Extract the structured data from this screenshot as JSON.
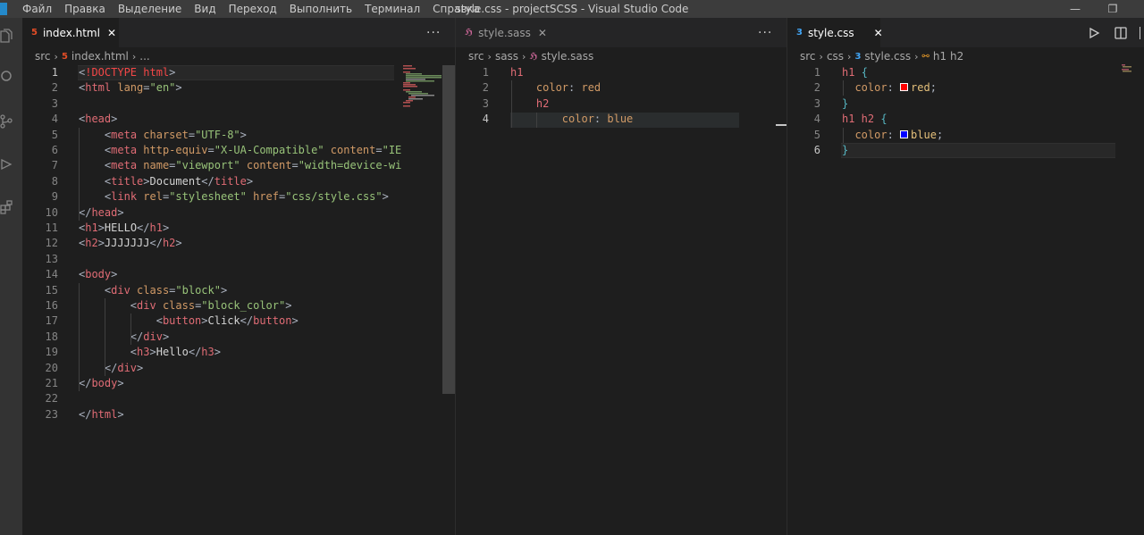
{
  "window": {
    "title": "style.css - projectSCSS - Visual Studio Code",
    "menu": [
      "Файл",
      "Правка",
      "Выделение",
      "Вид",
      "Переход",
      "Выполнить",
      "Терминал",
      "Справка"
    ],
    "minimize": "—",
    "restore": "❐"
  },
  "activity_icons": [
    "files-icon",
    "search-icon",
    "source-control-icon",
    "run-debug-icon",
    "extensions-icon"
  ],
  "pane1": {
    "tab": {
      "icon": "5",
      "label": "index.html",
      "close": "✕"
    },
    "more": "···",
    "breadcrumb": [
      "src",
      "index.html",
      "..."
    ],
    "lines": [
      {
        "n": "1",
        "parts": [
          [
            "pun",
            "<"
          ],
          [
            "tag",
            "!DOCTYPE html"
          ],
          [
            "pun",
            ">"
          ]
        ]
      },
      {
        "n": "2",
        "parts": [
          [
            "pun",
            "<"
          ],
          [
            "tag2",
            "html "
          ],
          [
            "attr",
            "lang"
          ],
          [
            "pun",
            "="
          ],
          [
            "str",
            "\"en\""
          ],
          [
            "pun",
            ">"
          ]
        ]
      },
      {
        "n": "3",
        "parts": []
      },
      {
        "n": "4",
        "parts": [
          [
            "pun",
            "<"
          ],
          [
            "tag2",
            "head"
          ],
          [
            "pun",
            ">"
          ]
        ]
      },
      {
        "n": "5",
        "parts": [
          [
            "plain",
            "    "
          ],
          [
            "pun",
            "<"
          ],
          [
            "tag2",
            "meta "
          ],
          [
            "attr",
            "charset"
          ],
          [
            "pun",
            "="
          ],
          [
            "str",
            "\"UTF-8\""
          ],
          [
            "pun",
            ">"
          ]
        ]
      },
      {
        "n": "6",
        "parts": [
          [
            "plain",
            "    "
          ],
          [
            "pun",
            "<"
          ],
          [
            "tag2",
            "meta "
          ],
          [
            "attr",
            "http-equiv"
          ],
          [
            "pun",
            "="
          ],
          [
            "str",
            "\"X-UA-Compatible\" "
          ],
          [
            "attr",
            "content"
          ],
          [
            "pun",
            "="
          ],
          [
            "str",
            "\"IE"
          ]
        ]
      },
      {
        "n": "7",
        "parts": [
          [
            "plain",
            "    "
          ],
          [
            "pun",
            "<"
          ],
          [
            "tag2",
            "meta "
          ],
          [
            "attr",
            "name"
          ],
          [
            "pun",
            "="
          ],
          [
            "str",
            "\"viewport\" "
          ],
          [
            "attr",
            "content"
          ],
          [
            "pun",
            "="
          ],
          [
            "str",
            "\"width=device-wi"
          ]
        ]
      },
      {
        "n": "8",
        "parts": [
          [
            "plain",
            "    "
          ],
          [
            "pun",
            "<"
          ],
          [
            "tag2",
            "title"
          ],
          [
            "pun",
            ">"
          ],
          [
            "plain",
            "Document"
          ],
          [
            "pun",
            "</"
          ],
          [
            "tag2",
            "title"
          ],
          [
            "pun",
            ">"
          ]
        ]
      },
      {
        "n": "9",
        "parts": [
          [
            "plain",
            "    "
          ],
          [
            "pun",
            "<"
          ],
          [
            "tag2",
            "link "
          ],
          [
            "attr",
            "rel"
          ],
          [
            "pun",
            "="
          ],
          [
            "str",
            "\"stylesheet\" "
          ],
          [
            "attr",
            "href"
          ],
          [
            "pun",
            "="
          ],
          [
            "str",
            "\"css/style.css\""
          ],
          [
            "pun",
            ">"
          ]
        ]
      },
      {
        "n": "10",
        "parts": [
          [
            "pun",
            "</"
          ],
          [
            "tag2",
            "head"
          ],
          [
            "pun",
            ">"
          ]
        ]
      },
      {
        "n": "11",
        "parts": [
          [
            "pun",
            "<"
          ],
          [
            "tag2",
            "h1"
          ],
          [
            "pun",
            ">"
          ],
          [
            "plain",
            "HELLO"
          ],
          [
            "pun",
            "</"
          ],
          [
            "tag2",
            "h1"
          ],
          [
            "pun",
            ">"
          ]
        ]
      },
      {
        "n": "12",
        "parts": [
          [
            "pun",
            "<"
          ],
          [
            "tag2",
            "h2"
          ],
          [
            "pun",
            ">"
          ],
          [
            "plain",
            "JJJJJJJ"
          ],
          [
            "pun",
            "</"
          ],
          [
            "tag2",
            "h2"
          ],
          [
            "pun",
            ">"
          ]
        ]
      },
      {
        "n": "13",
        "parts": []
      },
      {
        "n": "14",
        "parts": [
          [
            "pun",
            "<"
          ],
          [
            "tag2",
            "body"
          ],
          [
            "pun",
            ">"
          ]
        ]
      },
      {
        "n": "15",
        "parts": [
          [
            "plain",
            "    "
          ],
          [
            "pun",
            "<"
          ],
          [
            "tag2",
            "div "
          ],
          [
            "attr",
            "class"
          ],
          [
            "pun",
            "="
          ],
          [
            "str",
            "\"block\""
          ],
          [
            "pun",
            ">"
          ]
        ]
      },
      {
        "n": "16",
        "parts": [
          [
            "plain",
            "        "
          ],
          [
            "pun",
            "<"
          ],
          [
            "tag2",
            "div "
          ],
          [
            "attr",
            "class"
          ],
          [
            "pun",
            "="
          ],
          [
            "str",
            "\"block_color\""
          ],
          [
            "pun",
            ">"
          ]
        ]
      },
      {
        "n": "17",
        "parts": [
          [
            "plain",
            "            "
          ],
          [
            "pun",
            "<"
          ],
          [
            "tag2",
            "button"
          ],
          [
            "pun",
            ">"
          ],
          [
            "plain",
            "Click"
          ],
          [
            "pun",
            "</"
          ],
          [
            "tag2",
            "button"
          ],
          [
            "pun",
            ">"
          ]
        ]
      },
      {
        "n": "18",
        "parts": [
          [
            "plain",
            "        "
          ],
          [
            "pun",
            "</"
          ],
          [
            "tag2",
            "div"
          ],
          [
            "pun",
            ">"
          ]
        ]
      },
      {
        "n": "19",
        "parts": [
          [
            "plain",
            "        "
          ],
          [
            "pun",
            "<"
          ],
          [
            "tag2",
            "h3"
          ],
          [
            "pun",
            ">"
          ],
          [
            "plain",
            "Hello"
          ],
          [
            "pun",
            "</"
          ],
          [
            "tag2",
            "h3"
          ],
          [
            "pun",
            ">"
          ]
        ]
      },
      {
        "n": "20",
        "parts": [
          [
            "plain",
            "    "
          ],
          [
            "pun",
            "</"
          ],
          [
            "tag2",
            "div"
          ],
          [
            "pun",
            ">"
          ]
        ]
      },
      {
        "n": "21",
        "parts": [
          [
            "pun",
            "</"
          ],
          [
            "tag2",
            "body"
          ],
          [
            "pun",
            ">"
          ]
        ]
      },
      {
        "n": "22",
        "parts": []
      },
      {
        "n": "23",
        "parts": [
          [
            "pun",
            "</"
          ],
          [
            "tag2",
            "html"
          ],
          [
            "pun",
            ">"
          ]
        ]
      }
    ]
  },
  "pane2": {
    "tab": {
      "icon": "ℌ",
      "label": "style.sass",
      "close": "✕"
    },
    "more": "···",
    "breadcrumb": [
      "src",
      "sass",
      "style.sass"
    ],
    "lines": [
      {
        "n": "1",
        "parts": [
          [
            "sel",
            "h1"
          ]
        ]
      },
      {
        "n": "2",
        "parts": [
          [
            "plain",
            "    "
          ],
          [
            "prop",
            "color"
          ],
          [
            "pun",
            ": "
          ],
          [
            "val2",
            "red"
          ]
        ]
      },
      {
        "n": "3",
        "parts": [
          [
            "plain",
            "    "
          ],
          [
            "sel",
            "h2"
          ]
        ]
      },
      {
        "n": "4",
        "parts": [
          [
            "plain",
            "        "
          ],
          [
            "prop",
            "color"
          ],
          [
            "pun",
            ": "
          ],
          [
            "val2",
            "blue"
          ]
        ]
      }
    ]
  },
  "pane3": {
    "tab": {
      "icon": "3",
      "label": "style.css",
      "close": "✕"
    },
    "breadcrumb": [
      "src",
      "css",
      "style.css",
      "h1 h2"
    ],
    "lines": [
      {
        "n": "1",
        "parts": [
          [
            "sel",
            "h1 "
          ],
          [
            "brace",
            "{"
          ]
        ]
      },
      {
        "n": "2",
        "parts": [
          [
            "plain",
            "  "
          ],
          [
            "prop",
            "color"
          ],
          [
            "pun",
            ": "
          ],
          [
            "swatch",
            "#ff0000"
          ],
          [
            "val",
            "red"
          ],
          [
            "pun",
            ";"
          ]
        ]
      },
      {
        "n": "3",
        "parts": [
          [
            "brace",
            "}"
          ]
        ]
      },
      {
        "n": "4",
        "parts": [
          [
            "sel",
            "h1 h2 "
          ],
          [
            "brace",
            "{"
          ]
        ]
      },
      {
        "n": "5",
        "parts": [
          [
            "plain",
            "  "
          ],
          [
            "prop",
            "color"
          ],
          [
            "pun",
            ": "
          ],
          [
            "swatch",
            "#0000ff"
          ],
          [
            "val",
            "blue"
          ],
          [
            "pun",
            ";"
          ]
        ]
      },
      {
        "n": "6",
        "parts": [
          [
            "brace",
            "}"
          ]
        ]
      }
    ]
  }
}
